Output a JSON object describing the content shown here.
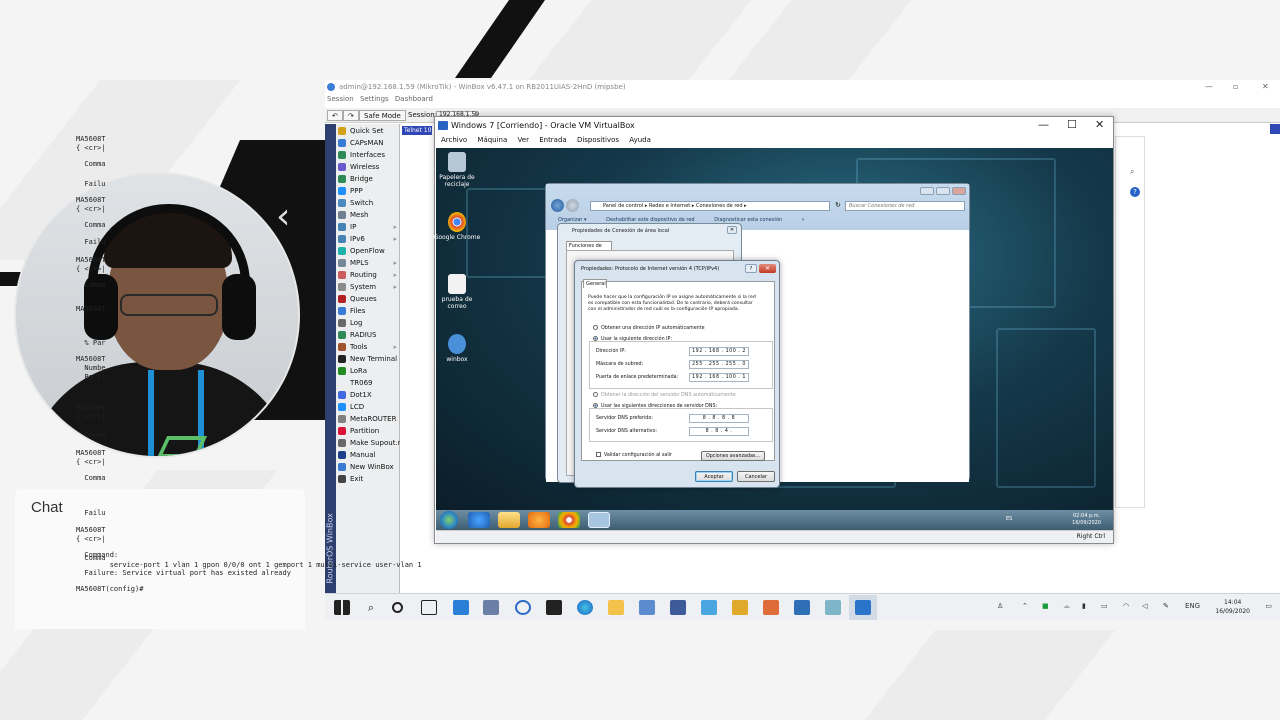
{
  "stream": {
    "chat_title": "Chat"
  },
  "winbox": {
    "title": "admin@192.168.1.59 (MikroTik) - WinBox v6.47.1 on RB2011UiAS-2HnD (mipsbe)",
    "menu": [
      "Session",
      "Settings",
      "Dashboard"
    ],
    "toolbar": {
      "safe_mode": "Safe Mode",
      "session_label": "Session:",
      "session_value": "192.168.1.59"
    },
    "vertical_label": "RouterOS WinBox",
    "sidebar": [
      {
        "label": "Quick Set",
        "icon": "quickset-icon",
        "color": "#d4a017",
        "arrow": false
      },
      {
        "label": "CAPsMAN",
        "icon": "capsman-icon",
        "color": "#3a7bd5",
        "arrow": false
      },
      {
        "label": "Interfaces",
        "icon": "interfaces-icon",
        "color": "#2e8b57",
        "arrow": false
      },
      {
        "label": "Wireless",
        "icon": "wireless-icon",
        "color": "#6a5acd",
        "arrow": false
      },
      {
        "label": "Bridge",
        "icon": "bridge-icon",
        "color": "#2e8b57",
        "arrow": false
      },
      {
        "label": "PPP",
        "icon": "ppp-icon",
        "color": "#1e90ff",
        "arrow": false
      },
      {
        "label": "Switch",
        "icon": "switch-icon",
        "color": "#4b8bbe",
        "arrow": false
      },
      {
        "label": "Mesh",
        "icon": "mesh-icon",
        "color": "#708090",
        "arrow": false
      },
      {
        "label": "IP",
        "icon": "ip-icon",
        "color": "#4682b4",
        "arrow": true
      },
      {
        "label": "IPv6",
        "icon": "ipv6-icon",
        "color": "#4682b4",
        "arrow": true
      },
      {
        "label": "OpenFlow",
        "icon": "openflow-icon",
        "color": "#20b2aa",
        "arrow": false
      },
      {
        "label": "MPLS",
        "icon": "mpls-icon",
        "color": "#778899",
        "arrow": true
      },
      {
        "label": "Routing",
        "icon": "routing-icon",
        "color": "#cd5c5c",
        "arrow": true
      },
      {
        "label": "System",
        "icon": "system-icon",
        "color": "#8b8b8b",
        "arrow": true
      },
      {
        "label": "Queues",
        "icon": "queues-icon",
        "color": "#b22222",
        "arrow": false
      },
      {
        "label": "Files",
        "icon": "files-icon",
        "color": "#3a7bd5",
        "arrow": false
      },
      {
        "label": "Log",
        "icon": "log-icon",
        "color": "#696969",
        "arrow": false
      },
      {
        "label": "RADIUS",
        "icon": "radius-icon",
        "color": "#2e8b57",
        "arrow": false
      },
      {
        "label": "Tools",
        "icon": "tools-icon",
        "color": "#a0522d",
        "arrow": true
      },
      {
        "label": "New Terminal",
        "icon": "terminal-icon",
        "color": "#222222",
        "arrow": false
      },
      {
        "label": "LoRa",
        "icon": "lora-icon",
        "color": "#228b22",
        "arrow": false
      },
      {
        "label": "TR069",
        "icon": "tr069-icon",
        "color": "#eceef0",
        "arrow": false
      },
      {
        "label": "Dot1X",
        "icon": "dot1x-icon",
        "color": "#4169e1",
        "arrow": false
      },
      {
        "label": "LCD",
        "icon": "lcd-icon",
        "color": "#1e90ff",
        "arrow": false
      },
      {
        "label": "MetaROUTER",
        "icon": "metarouter-icon",
        "color": "#808080",
        "arrow": false
      },
      {
        "label": "Partition",
        "icon": "partition-icon",
        "color": "#dc143c",
        "arrow": false
      },
      {
        "label": "Make Supout.rif",
        "icon": "supout-icon",
        "color": "#696969",
        "arrow": false
      },
      {
        "label": "Manual",
        "icon": "manual-icon",
        "color": "#1e3f8a",
        "arrow": false
      },
      {
        "label": "New WinBox",
        "icon": "winbox-icon",
        "color": "#3a7bd5",
        "arrow": false
      },
      {
        "label": "Exit",
        "icon": "exit-icon",
        "color": "#444444",
        "arrow": false
      }
    ],
    "terminal": {
      "tab": "Telnet 10",
      "lines": [
        "MA5608T",
        "{ <cr>|",
        "  Comma",
        "  Failu",
        "MA5608T",
        "{ <cr>|",
        "  Comma",
        "  Failu",
        "MA5608T",
        "{ <cr>|",
        "  Comma",
        "MA5608T",
        "  % Par",
        "MA5608T",
        "  Numbe",
        "  Porti",
        "MA5608T",
        "{ <cr>|",
        "  Comma",
        "MA5608T",
        "{ <cr>|",
        "  Comma",
        "  Failu",
        "MA5608T",
        "{ <cr>|",
        "  Comma",
        "  Failu",
        "MA5608T",
        "{ <cr>|"
      ],
      "command_label": "  Command:",
      "command": "        service-port 1 vlan 1 gpon 0/0/0 ont 1 gemport 1 multi-service user-vlan 1",
      "failure": "  Failure: Service virtual port has existed already",
      "prompt": "MA5608T(config)#"
    }
  },
  "virtualbox": {
    "title": "Windows 7 [Corriendo] - Oracle VM VirtualBox",
    "menu": [
      "Archivo",
      "Máquina",
      "Ver",
      "Entrada",
      "Dispositivos",
      "Ayuda"
    ],
    "host_key": "Right Ctrl",
    "desktop_icons": [
      {
        "label": "Papelera de reciclaje",
        "icon": "recycle-bin-icon",
        "color": "#b8c7d6"
      },
      {
        "label": "Google Chrome",
        "icon": "chrome-icon",
        "color": "#db4437"
      },
      {
        "label": "prueba de correo",
        "icon": "document-icon",
        "color": "#f2f2f2"
      },
      {
        "label": "winbox",
        "icon": "winbox-app-icon",
        "color": "#4a90d9"
      }
    ],
    "taskbar_clock": {
      "time": "02:04 p.m.",
      "date": "16/09/2020"
    },
    "tray_lang": "ES"
  },
  "explorer": {
    "breadcrumb": [
      "Panel de control",
      "Redes e Internet",
      "Conexiones de red"
    ],
    "search_placeholder": "Buscar Conexiones de red",
    "commands": [
      "Organizar ▾",
      "Deshabilitar este dispositivo de red",
      "Diagnosticar esta conexión",
      "»"
    ]
  },
  "conn_props": {
    "title": "Propiedades de Conexión de área local",
    "tab": "Funciones de red"
  },
  "ipv4": {
    "title": "Propiedades: Protocolo de Internet versión 4 (TCP/IPv4)",
    "help": "?",
    "close": "✕",
    "tab": "General",
    "description": "Puede hacer que la configuración IP se asigne automáticamente si la red es compatible con esta funcionalidad. De lo contrario, deberá consultar con el administrador de red cuál es la configuración IP apropiada.",
    "ip_auto": "Obtener una dirección IP automáticamente",
    "ip_manual": "Usar la siguiente dirección IP:",
    "fields": {
      "ip_label": "Dirección IP:",
      "ip_value": "192 . 168 . 100 . 2",
      "mask_label": "Máscara de subred:",
      "mask_value": "255 . 255 . 255 . 0",
      "gw_label": "Puerta de enlace predeterminada:",
      "gw_value": "192 . 168 . 100 . 1"
    },
    "dns_auto": "Obtener la dirección del servidor DNS automáticamente",
    "dns_manual": "Usar las siguientes direcciones de servidor DNS:",
    "dns": {
      "pref_label": "Servidor DNS preferido:",
      "pref_value": "8 . 8 . 8 . 8",
      "alt_label": "Servidor DNS alternativo:",
      "alt_value": "8 . 8 . 4 ."
    },
    "validate": "Validar configuración al salir",
    "advanced": "Opciones avanzadas...",
    "ok": "Aceptar",
    "cancel": "Cancelar"
  },
  "host_taskbar": {
    "lang": "ENG",
    "time": "14:04",
    "date": "16/09/2020"
  }
}
